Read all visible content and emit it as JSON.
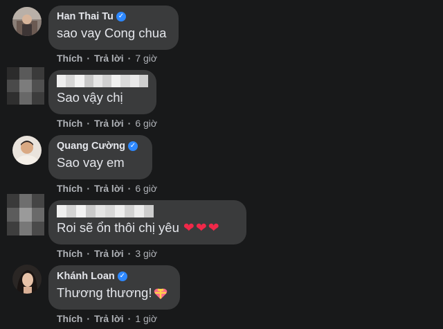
{
  "comments": [
    {
      "author": "Han Thai Tu",
      "verified": true,
      "text": "sao vay Cong chua",
      "like_label": "Thích",
      "reply_label": "Trả lời",
      "time": "7 giờ"
    },
    {
      "author": "",
      "verified": false,
      "text": "Sao vậy chị",
      "like_label": "Thích",
      "reply_label": "Trả lời",
      "time": "6 giờ"
    },
    {
      "author": "Quang Cường",
      "verified": true,
      "text": "Sao vay em",
      "like_label": "Thích",
      "reply_label": "Trả lời",
      "time": "6 giờ"
    },
    {
      "author": "",
      "verified": false,
      "text": "Roi sẽ ổn thôi chị yêu",
      "emoji": [
        "red-heart",
        "red-heart",
        "red-heart"
      ],
      "like_label": "Thích",
      "reply_label": "Trả lời",
      "time": "3 giờ"
    },
    {
      "author": "Khánh Loan",
      "verified": true,
      "text": "Thương thương!",
      "emoji": [
        "heart-gift"
      ],
      "like_label": "Thích",
      "reply_label": "Trả lời",
      "time": "1 giờ"
    }
  ],
  "colors": {
    "background": "#18191a",
    "bubble": "#3a3b3c",
    "text": "#e4e6eb",
    "secondary_text": "#b0b3b8",
    "verified": "#2d88ff",
    "heart": "#f02849"
  }
}
